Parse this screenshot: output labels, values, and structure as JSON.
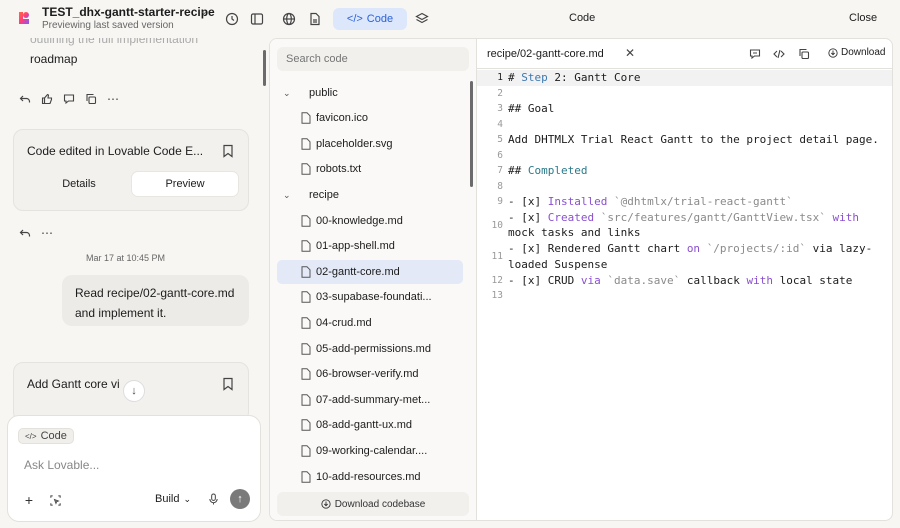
{
  "header": {
    "project_title": "TEST_dhx-gantt-starter-recipe",
    "project_subtitle": "Previewing last saved version",
    "code_button_label": "Code",
    "panel_title": "Code",
    "close_label": "Close"
  },
  "chat": {
    "faded_text": "outlining the full implementation",
    "roadmap_text": "roadmap",
    "card1_title": "Code edited in Lovable Code E...",
    "card1_tabs": [
      "Details",
      "Preview"
    ],
    "timestamp": "Mar 17 at 10:45 PM",
    "user_message": "Read recipe/02-gantt-core.md and implement it.",
    "card2_title": "Add Gantt core vi",
    "input": {
      "chip_label": "Code",
      "placeholder": "Ask Lovable...",
      "build_label": "Build"
    }
  },
  "file_tree": {
    "search_placeholder": "Search code",
    "items": [
      {
        "label": "public",
        "type": "folder"
      },
      {
        "label": "favicon.ico",
        "type": "file"
      },
      {
        "label": "placeholder.svg",
        "type": "file"
      },
      {
        "label": "robots.txt",
        "type": "file"
      },
      {
        "label": "recipe",
        "type": "folder"
      },
      {
        "label": "00-knowledge.md",
        "type": "file"
      },
      {
        "label": "01-app-shell.md",
        "type": "file"
      },
      {
        "label": "02-gantt-core.md",
        "type": "file",
        "selected": true
      },
      {
        "label": "03-supabase-foundati...",
        "type": "file"
      },
      {
        "label": "04-crud.md",
        "type": "file"
      },
      {
        "label": "05-add-permissions.md",
        "type": "file"
      },
      {
        "label": "06-browser-verify.md",
        "type": "file"
      },
      {
        "label": "07-add-summary-met...",
        "type": "file"
      },
      {
        "label": "08-add-gantt-ux.md",
        "type": "file"
      },
      {
        "label": "09-working-calendar....",
        "type": "file"
      },
      {
        "label": "10-add-resources.md",
        "type": "file"
      }
    ],
    "download_label": "Download codebase"
  },
  "editor": {
    "tab_name": "recipe/02-gantt-core.md",
    "download_label": "Download",
    "lines": [
      {
        "n": "1",
        "parts": [
          [
            "t",
            "# "
          ],
          [
            "kb",
            "Step"
          ],
          [
            "t",
            " 2: Gantt Core"
          ]
        ]
      },
      {
        "n": "2",
        "parts": []
      },
      {
        "n": "3",
        "parts": [
          [
            "t",
            "## Goal"
          ]
        ]
      },
      {
        "n": "4",
        "parts": []
      },
      {
        "n": "5",
        "parts": [
          [
            "t",
            "Add DHTMLX Trial React Gantt to the project detail page."
          ]
        ]
      },
      {
        "n": "6",
        "parts": []
      },
      {
        "n": "7",
        "parts": [
          [
            "t",
            "## "
          ],
          [
            "kt",
            "Completed"
          ]
        ]
      },
      {
        "n": "8",
        "parts": []
      },
      {
        "n": "9",
        "parts": [
          [
            "t",
            "- [x] "
          ],
          [
            "kp",
            "Installed"
          ],
          [
            "t",
            " "
          ],
          [
            "s",
            "`@dhtmlx/trial-react-gantt`"
          ]
        ]
      },
      {
        "n": "10",
        "parts": [
          [
            "t",
            "- [x] "
          ],
          [
            "kp",
            "Created"
          ],
          [
            "t",
            " "
          ],
          [
            "s",
            "`src/features/gantt/GanttView.tsx`"
          ],
          [
            "t",
            " "
          ],
          [
            "kp",
            "with"
          ],
          [
            "t",
            " mock tasks and links"
          ]
        ]
      },
      {
        "n": "11",
        "parts": [
          [
            "t",
            "- [x] Rendered Gantt chart "
          ],
          [
            "kp",
            "on"
          ],
          [
            "t",
            " "
          ],
          [
            "s",
            "`/projects/:id`"
          ],
          [
            "t",
            " via lazy-loaded Suspense"
          ]
        ]
      },
      {
        "n": "12",
        "parts": [
          [
            "t",
            "- [x] CRUD "
          ],
          [
            "kp",
            "via"
          ],
          [
            "t",
            " "
          ],
          [
            "s",
            "`data.save`"
          ],
          [
            "t",
            " callback "
          ],
          [
            "kp",
            "with"
          ],
          [
            "t",
            " local state"
          ]
        ]
      },
      {
        "n": "13",
        "parts": []
      }
    ]
  },
  "colors": {
    "accent": "#2a62d9",
    "accent_bg": "#dce7fb",
    "selected_row": "#e3e9f6",
    "keyword": "#8a4fd0",
    "string": "#8a8a8a"
  }
}
